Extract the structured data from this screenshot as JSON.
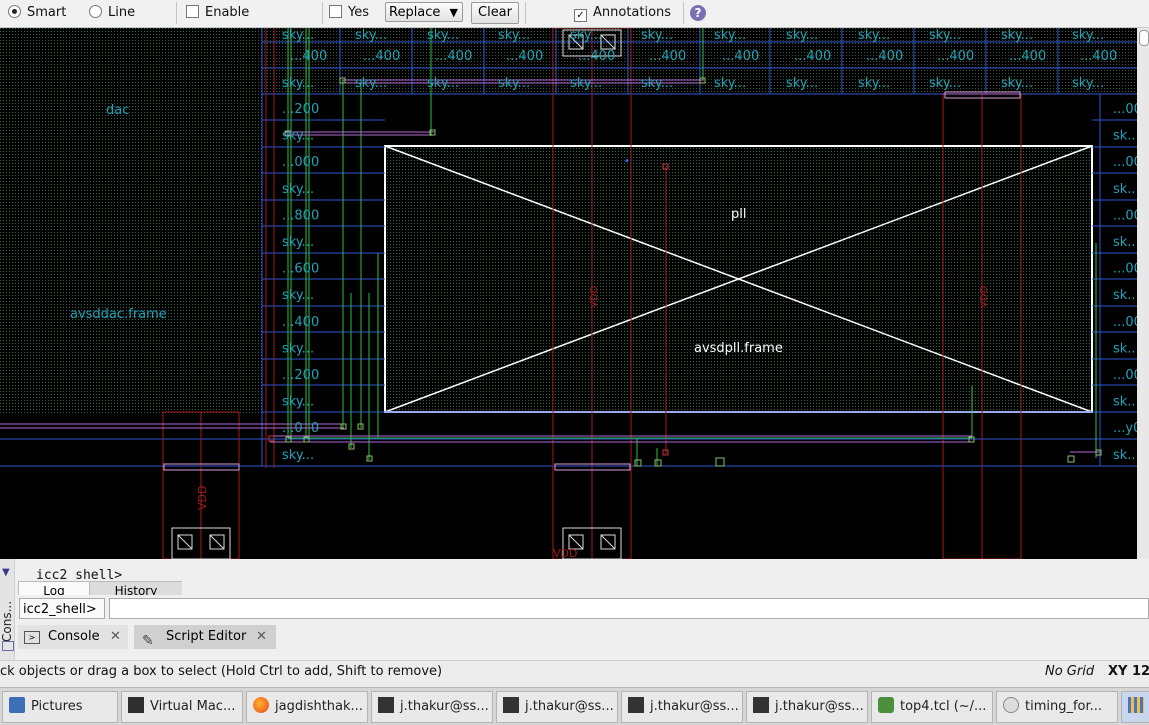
{
  "toolbar": {
    "smart_label": "Smart",
    "line_label": "Line",
    "enable_label": "Enable",
    "yes_label": "Yes",
    "mode_select": "Replace",
    "clear_button": "Clear",
    "annotations_label": "Annotations",
    "help_icon": "question-icon"
  },
  "canvas": {
    "labels": {
      "dac": "dac",
      "avsddac": "avsddac.frame",
      "pll": "pll",
      "avsdpll": "avsdpll.frame",
      "vdd_left": "VDD",
      "vdd_mid": "VDD",
      "vdd_right_a": "VDD",
      "vdd_right_b": "VDD",
      "cell_top": "sky...",
      "cell_val": "...400",
      "left_col": [
        "...200",
        "sky...",
        "...000",
        "sky...",
        "...800",
        "sky...",
        "...600",
        "sky...",
        "...400",
        "sky...",
        "...200",
        "sky...",
        "...0  0",
        "sky..."
      ],
      "right_col": [
        "...00",
        "sk...",
        "...00",
        "sk...",
        "...00",
        "sk...",
        "...00",
        "sk...",
        "...00",
        "sk...",
        "...00",
        "sk...",
        "...y0",
        "sk..."
      ]
    }
  },
  "console": {
    "shell_output": "icc2_shell>",
    "tabs": [
      "Log",
      "History"
    ],
    "prompt": "icc2_shell>",
    "input_value": "",
    "side_label": "Cons...",
    "bottom_tabs": [
      "Console",
      "Script Editor"
    ]
  },
  "status": {
    "hint": "ck objects or drag a box to select (Hold Ctrl to add, Shift to remove)",
    "grid": "No Grid",
    "xy": "XY 12("
  },
  "taskbar": {
    "items": [
      "Pictures",
      "Virtual Mac...",
      "jagdishthak...",
      "j.thakur@ss...",
      "j.thakur@ss...",
      "j.thakur@ss...",
      "j.thakur@ss...",
      "top4.tcl (~/...",
      "timing_for..."
    ]
  }
}
